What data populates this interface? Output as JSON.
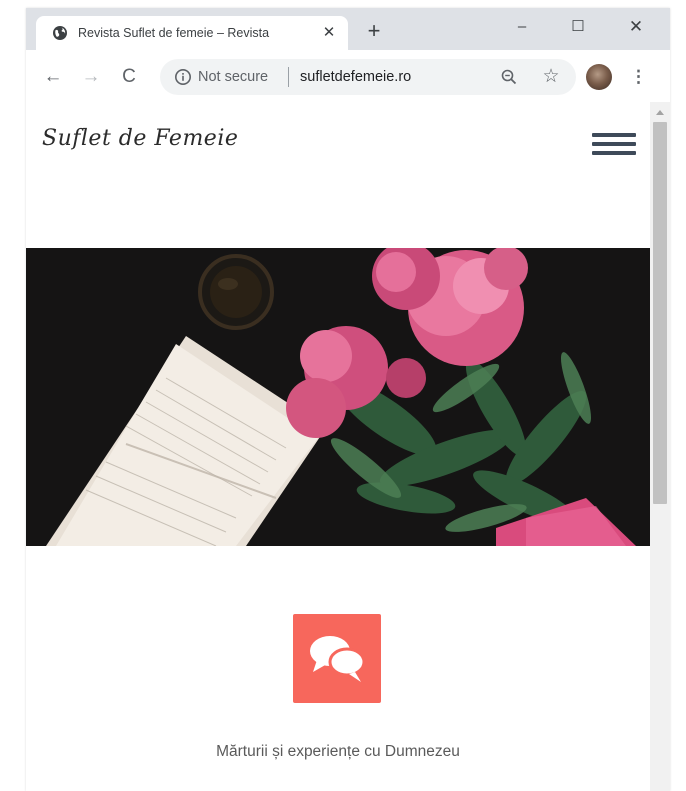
{
  "browser": {
    "tab_title": "Revista Suflet de femeie – Revista",
    "tab_close_glyph": "✕",
    "new_tab_glyph": "+",
    "window_minimize_glyph": "–",
    "window_maximize_glyph": "☐",
    "window_close_glyph": "✕",
    "back_glyph": "←",
    "forward_glyph": "→",
    "reload_glyph": "C",
    "security_label": "Not secure",
    "url": "sufletdefemeie.ro",
    "star_glyph": "☆",
    "menu_glyph": "⋮"
  },
  "site": {
    "logo_text": "Suflet de Femeie",
    "feature_title": "Mărturii și experiențe cu Dumnezeu"
  },
  "colors": {
    "accent": "#f7675c",
    "menu_icon": "#3e4a59",
    "hero_background": "#151414"
  },
  "icons": {
    "tab_favicon": "globe-icon",
    "omnibox_info": "info-icon",
    "omnibox_zoom": "zoom-icon",
    "menu": "hamburger-icon",
    "feature": "chat-bubbles-icon"
  }
}
